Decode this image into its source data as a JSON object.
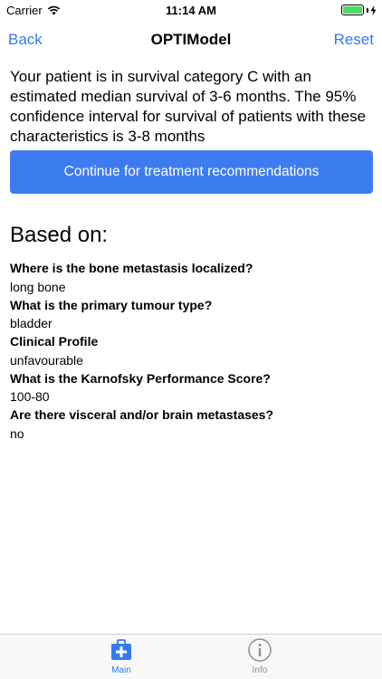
{
  "status_bar": {
    "carrier": "Carrier",
    "time": "11:14 AM",
    "battery_level": 1.0,
    "icons": [
      "wifi-icon",
      "battery-icon",
      "charging-bolt-icon"
    ]
  },
  "nav": {
    "back_label": "Back",
    "title": "OPTIModel",
    "reset_label": "Reset"
  },
  "main": {
    "summary": "Your patient is in survival category C with an estimated median survival of 3-6 months. The 95% confidence interval for survival of patients with these characteristics is 3-8 months",
    "continue_label": "Continue for treatment recommendations",
    "based_on_heading": "Based on:",
    "answers": [
      {
        "question": "Where is the bone metastasis localized?",
        "answer": "long bone"
      },
      {
        "question": "What is the primary tumour type?",
        "answer": "bladder"
      },
      {
        "question": "Clinical Profile",
        "answer": "unfavourable"
      },
      {
        "question": "What is the Karnofsky Performance Score?",
        "answer": "100-80"
      },
      {
        "question": "Are there visceral and/or brain metastases?",
        "answer": "no"
      }
    ]
  },
  "tab_bar": {
    "tabs": [
      {
        "label": "Main",
        "icon": "medical-kit-icon",
        "selected": true
      },
      {
        "label": "Info",
        "icon": "info-icon",
        "selected": false
      }
    ]
  },
  "colors": {
    "accent": "#3478f6",
    "button_bg": "#3d7cf0",
    "battery": "#4cd964",
    "tab_inactive": "#8e8e93"
  }
}
